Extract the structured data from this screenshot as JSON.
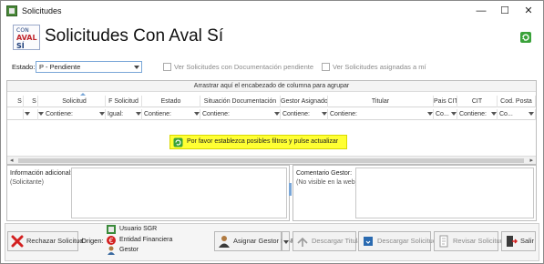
{
  "window": {
    "title": "Solicitudes",
    "controls": {
      "minimize": "—",
      "maximize": "☐",
      "close": "✕"
    }
  },
  "header": {
    "logo": {
      "line1": "CON",
      "line2": "AVAL",
      "line3": "SÍ"
    },
    "title": "Solicitudes Con Aval Sí",
    "refresh_icon": "refresh-icon"
  },
  "filters": {
    "estado_label": "Estado:",
    "estado_value": "P - Pendiente",
    "doc_pendiente_label": "Ver Solicitudes con Documentación pendiente",
    "asignadas_label": "Ver Solicitudes asignadas a mí"
  },
  "grid": {
    "group_hint": "Arrastrar aquí el encabezado de columna para agrupar",
    "columns": [
      {
        "label": "S",
        "filter": ""
      },
      {
        "label": "S",
        "filter": ""
      },
      {
        "label": "Solicitud",
        "filter": "Contiene:"
      },
      {
        "label": "F Solicitud",
        "filter": "Igual:"
      },
      {
        "label": "Estado",
        "filter": "Contiene:"
      },
      {
        "label": "Situación Documentación",
        "filter": "Contiene:"
      },
      {
        "label": "Gestor Asignado",
        "filter": "Contiene:"
      },
      {
        "label": "Titular",
        "filter": "Contiene:"
      },
      {
        "label": "Pais CIT",
        "filter": "Co..."
      },
      {
        "label": "CIT",
        "filter": "Contiene:"
      },
      {
        "label": "Cod. Posta",
        "filter": "Co..."
      }
    ],
    "empty_message": "Por favor establezca posibles filtros y pulse actualizar"
  },
  "info": {
    "adicional_label": "Información adicional:",
    "adicional_sub": "(Solicitante)",
    "comentario_label": "Comentario Gestor:",
    "comentario_sub": "(No visible en la web)"
  },
  "toolbar": {
    "rechazar": "Rechazar Solicitud",
    "origen_label": "Origen:",
    "origen_items": [
      "Usuario SGR",
      "Entidad Financiera",
      "Gestor"
    ],
    "asignar": "Asignar Gestor SGR",
    "descargar_titular": "Descargar Titular",
    "descargar_solicitud": "Descargar Solicitud",
    "revisar": "Revisar Solicitud",
    "salir": "Salir"
  }
}
